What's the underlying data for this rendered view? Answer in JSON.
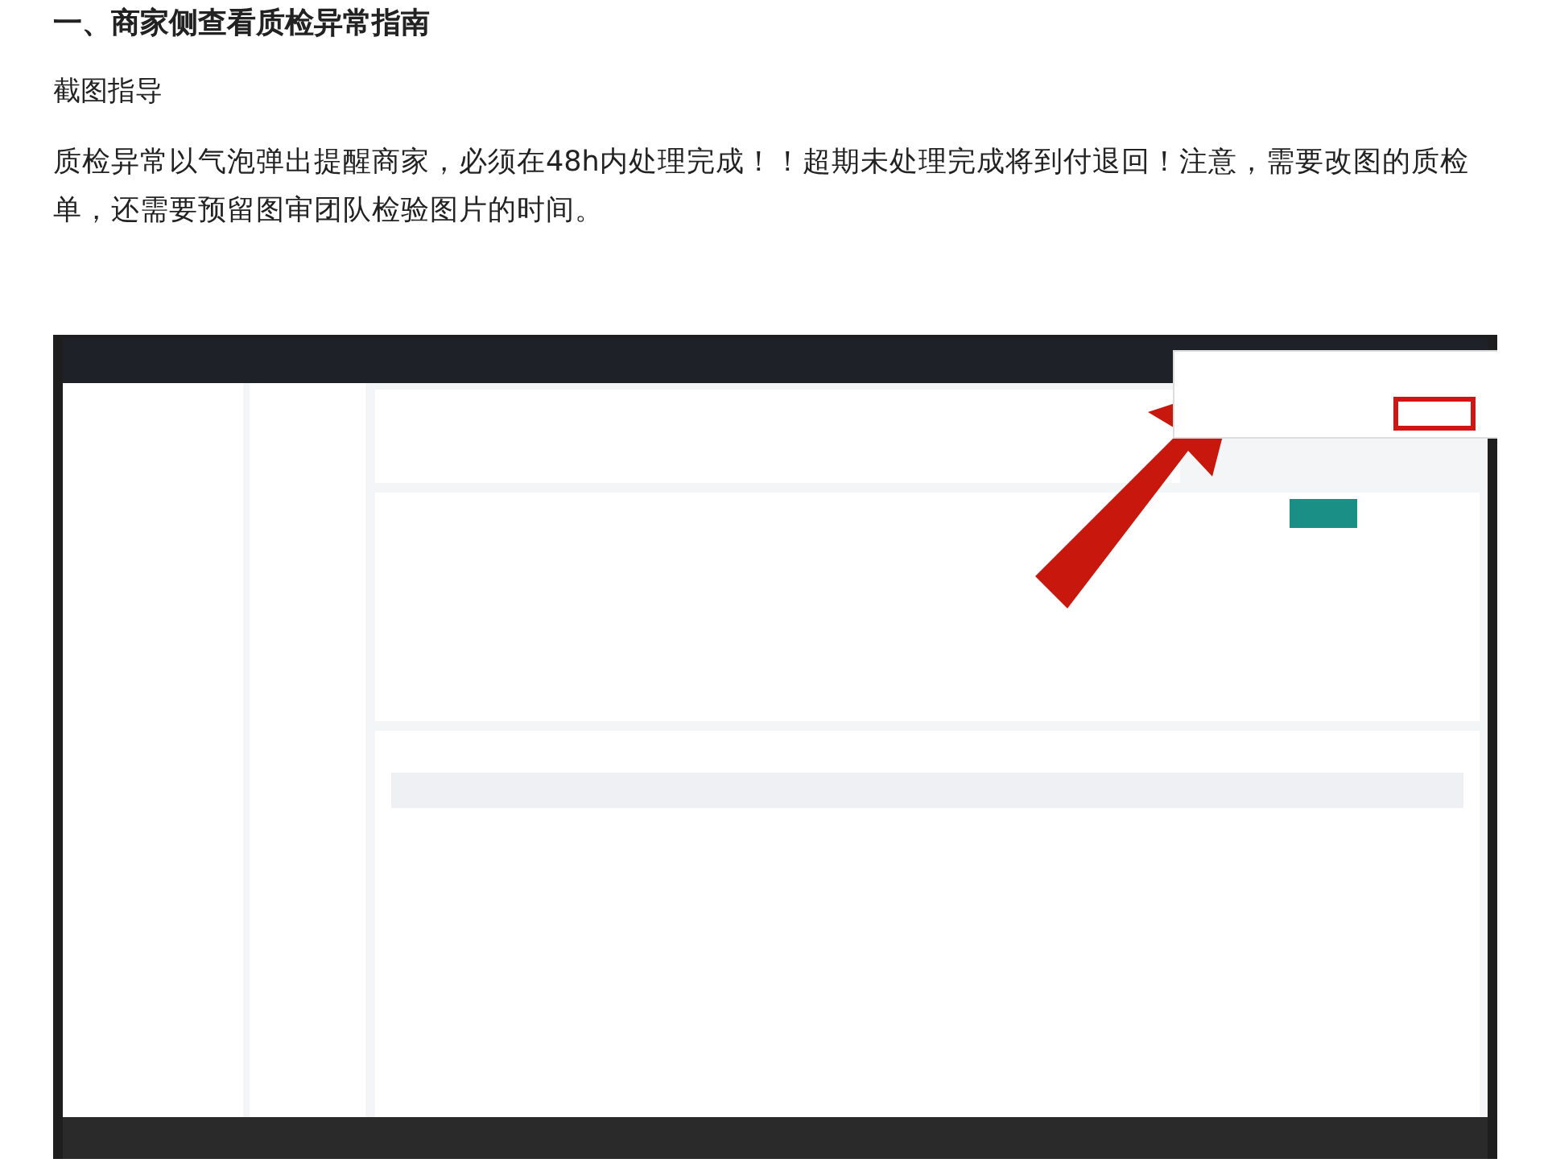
{
  "heading": "一、商家侧查看质检异常指南",
  "subheading": "截图指导",
  "paragraph": "质检异常以气泡弹出提醒商家，必须在48h内处理完成！！超期未处理完成将到付退回！注意，需要改图的质检单，还需要预留图审团队检验图片的时间。"
}
